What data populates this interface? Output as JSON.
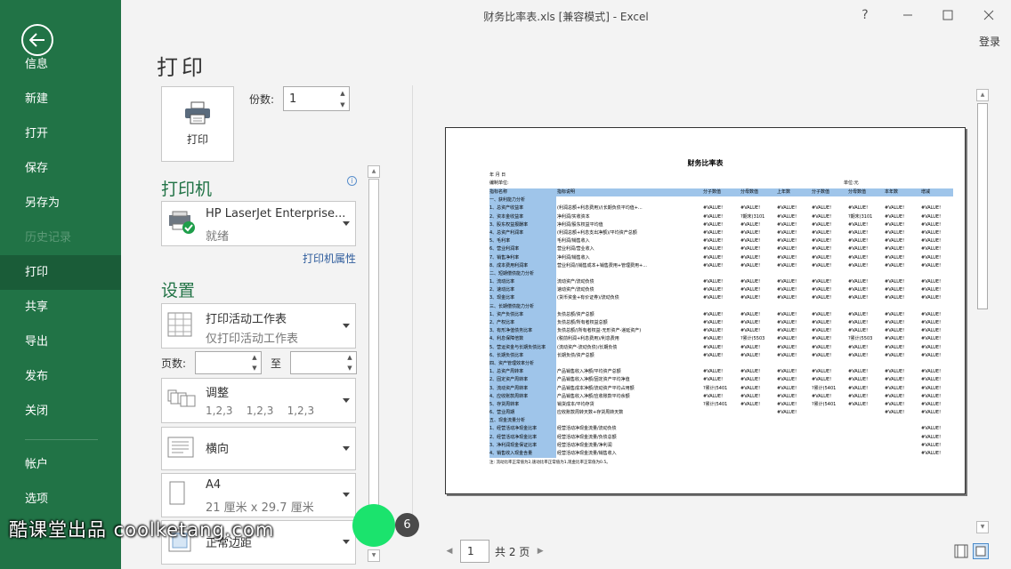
{
  "window": {
    "title": "财务比率表.xls  [兼容模式] - Excel",
    "help_label": "?",
    "login_label": "登录"
  },
  "nav": {
    "items": [
      {
        "label": "信息"
      },
      {
        "label": "新建"
      },
      {
        "label": "打开"
      },
      {
        "label": "保存"
      },
      {
        "label": "另存为"
      },
      {
        "label": "历史记录",
        "disabled": true
      },
      {
        "label": "打印",
        "active": true
      },
      {
        "label": "共享"
      },
      {
        "label": "导出"
      },
      {
        "label": "发布"
      },
      {
        "label": "关闭"
      },
      {
        "label": "帐户"
      },
      {
        "label": "选项"
      }
    ]
  },
  "print_panel": {
    "heading": "打印",
    "print_button_label": "打印",
    "copies_label": "份数:",
    "copies_value": "1",
    "printer_section": "打印机",
    "printer_name": "HP LaserJet Enterprise...",
    "printer_status": "就绪",
    "printer_properties_link": "打印机属性",
    "settings_section": "设置",
    "scope_main": "打印活动工作表",
    "scope_sub": "仅打印活动工作表",
    "pages_label": "页数:",
    "pages_to_label": "至",
    "collate_main": "调整",
    "collate_sub": "1,2,3    1,2,3    1,2,3",
    "orientation": "横向",
    "paper_main": "A4",
    "paper_sub": "21 厘米 x 29.7 厘米",
    "margins_main": "正常边距"
  },
  "preview": {
    "page_title": "财务比率表",
    "date_line": "年    月    日",
    "unit_left": "编制单位:",
    "unit_right": "单位:元",
    "headers": [
      "指标名称",
      "指标说明",
      "分子数值",
      "分母数值",
      "上年数",
      "分子数值",
      "分母数值",
      "本年数",
      "增减"
    ],
    "rows": [
      {
        "name": "一、获利能力分析",
        "desc": "",
        "section": true
      },
      {
        "name": "1、总资产收益率",
        "desc": "(利润总额+利息费用)/(长期负债平均值+...",
        "vals": [
          "#VALUE!",
          "#VALUE!",
          "#VALUE!",
          "#VALUE!",
          "#VALUE!",
          "#VALUE!",
          "#VALUE!"
        ]
      },
      {
        "name": "2、资本金收益率",
        "desc": "净利润/实收资本",
        "vals": [
          "#VALUE!",
          "?期末(3101",
          "#VALUE!",
          "#VALUE!",
          "?期末(3101",
          "#VALUE!",
          "#VALUE!"
        ]
      },
      {
        "name": "3、股东权益报酬率",
        "desc": "净利润/股东权益平均值",
        "vals": [
          "#VALUE!",
          "#VALUE!",
          "#VALUE!",
          "#VALUE!",
          "#VALUE!",
          "#VALUE!",
          "#VALUE!"
        ]
      },
      {
        "name": "4、总资产利润率",
        "desc": "(利润总额+利息支出净额)/平均资产总额",
        "vals": [
          "#VALUE!",
          "#VALUE!",
          "#VALUE!",
          "#VALUE!",
          "#VALUE!",
          "#VALUE!",
          "#VALUE!"
        ]
      },
      {
        "name": "5、毛利率",
        "desc": "毛利润/销售收入",
        "vals": [
          "#VALUE!",
          "#VALUE!",
          "#VALUE!",
          "#VALUE!",
          "#VALUE!",
          "#VALUE!",
          "#VALUE!"
        ]
      },
      {
        "name": "6、营业利润率",
        "desc": "营业利润/营业收入",
        "vals": [
          "#VALUE!",
          "#VALUE!",
          "#VALUE!",
          "#VALUE!",
          "#VALUE!",
          "#VALUE!",
          "#VALUE!"
        ]
      },
      {
        "name": "7、销售净利率",
        "desc": "净利润/销售收入",
        "vals": [
          "#VALUE!",
          "#VALUE!",
          "#VALUE!",
          "#VALUE!",
          "#VALUE!",
          "#VALUE!",
          "#VALUE!"
        ]
      },
      {
        "name": "8、成本费用利润率",
        "desc": "营业利润/(销售成本+销售费用+管理费用+...",
        "vals": [
          "#VALUE!",
          "#VALUE!",
          "#VALUE!",
          "#VALUE!",
          "#VALUE!",
          "#VALUE!",
          "#VALUE!"
        ]
      },
      {
        "name": "二、短期偿债能力分析",
        "desc": "",
        "section": true
      },
      {
        "name": "1、流动比率",
        "desc": "流动资产/流动负债",
        "vals": [
          "#VALUE!",
          "#VALUE!",
          "#VALUE!",
          "#VALUE!",
          "#VALUE!",
          "#VALUE!",
          "#VALUE!"
        ]
      },
      {
        "name": "2、速动比率",
        "desc": "速动资产/流动负债",
        "vals": [
          "#VALUE!",
          "#VALUE!",
          "#VALUE!",
          "#VALUE!",
          "#VALUE!",
          "#VALUE!",
          "#VALUE!"
        ]
      },
      {
        "name": "3、现金比率",
        "desc": "(货币资金+有价证券)/流动负债",
        "vals": [
          "#VALUE!",
          "#VALUE!",
          "#VALUE!",
          "#VALUE!",
          "#VALUE!",
          "#VALUE!",
          "#VALUE!"
        ]
      },
      {
        "name": "三、长期偿债能力分析",
        "desc": "",
        "section": true
      },
      {
        "name": "1、资产负债比率",
        "desc": "负债总额/资产总额",
        "vals": [
          "#VALUE!",
          "#VALUE!",
          "#VALUE!",
          "#VALUE!",
          "#VALUE!",
          "#VALUE!",
          "#VALUE!"
        ]
      },
      {
        "name": "2、产权比率",
        "desc": "负债总额/所有者权益总额",
        "vals": [
          "#VALUE!",
          "#VALUE!",
          "#VALUE!",
          "#VALUE!",
          "#VALUE!",
          "#VALUE!",
          "#VALUE!"
        ]
      },
      {
        "name": "3、有形净值债务比率",
        "desc": "负债总额/(所有者权益-无形资产-递延资产)",
        "vals": [
          "#VALUE!",
          "#VALUE!",
          "#VALUE!",
          "#VALUE!",
          "#VALUE!",
          "#VALUE!",
          "#VALUE!"
        ]
      },
      {
        "name": "4、利息保障倍数",
        "desc": "(税前利润+利息费用)/利息费用",
        "vals": [
          "#VALUE!",
          "?累计(5503",
          "#VALUE!",
          "#VALUE!",
          "?累计(5503",
          "#VALUE!",
          "#VALUE!"
        ]
      },
      {
        "name": "5、营运资金与长期负债比率",
        "desc": "(流动资产-流动负债)/长期负债",
        "vals": [
          "#VALUE!",
          "#VALUE!",
          "#VALUE!",
          "#VALUE!",
          "#VALUE!",
          "#VALUE!",
          "#VALUE!"
        ]
      },
      {
        "name": "6、长期负债比率",
        "desc": "长期负债/资产总额",
        "vals": [
          "#VALUE!",
          "#VALUE!",
          "#VALUE!",
          "#VALUE!",
          "#VALUE!",
          "#VALUE!",
          "#VALUE!"
        ]
      },
      {
        "name": "四、资产管理效率分析",
        "desc": "",
        "section": true
      },
      {
        "name": "1、总资产周转率",
        "desc": "产品销售收入净额/平均资产总额",
        "vals": [
          "#VALUE!",
          "#VALUE!",
          "#VALUE!",
          "#VALUE!",
          "#VALUE!",
          "#VALUE!",
          "#VALUE!"
        ]
      },
      {
        "name": "2、固定资产周转率",
        "desc": "产品销售收入净额/固定资产平均净值",
        "vals": [
          "#VALUE!",
          "#VALUE!",
          "#VALUE!",
          "#VALUE!",
          "#VALUE!",
          "#VALUE!",
          "#VALUE!"
        ]
      },
      {
        "name": "3、流动资产周转率",
        "desc": "产品销售成本净额/流动资产平均占用额",
        "vals": [
          "?累计(5401",
          "#VALUE!",
          "#VALUE!",
          "?累计(5401",
          "#VALUE!",
          "#VALUE!",
          "#VALUE!"
        ]
      },
      {
        "name": "4、应收账款周转率",
        "desc": "产品销售收入净额/应收账款平均余额",
        "vals": [
          "#VALUE!",
          "#VALUE!",
          "#VALUE!",
          "#VALUE!",
          "#VALUE!",
          "#VALUE!",
          "#VALUE!"
        ]
      },
      {
        "name": "5、存货周转率",
        "desc": "销货成本/平均存货",
        "vals": [
          "?累计(5401",
          "#VALUE!",
          "#VALUE!",
          "?累计(5401",
          "#VALUE!",
          "#VALUE!",
          "#VALUE!"
        ]
      },
      {
        "name": "6、营业周期",
        "desc": "应收账款周转天数+存货周转天数",
        "vals": [
          "",
          "",
          "#VALUE!",
          "",
          "",
          "#VALUE!",
          "#VALUE!"
        ]
      },
      {
        "name": "五、现金流量分析",
        "desc": "",
        "section": true
      },
      {
        "name": "1、经营活动净现金比率",
        "desc": "经营活动净现金流量/流动负债",
        "vals": [
          "",
          "",
          "",
          "",
          "",
          "",
          "#VALUE!"
        ]
      },
      {
        "name": "2、经营活动净现金比率",
        "desc": "经营活动净现金流量/负债总额",
        "vals": [
          "",
          "",
          "",
          "",
          "",
          "",
          "#VALUE!"
        ]
      },
      {
        "name": "3、净利润现金保证比率",
        "desc": "经营活动净现金流量/净利润",
        "vals": [
          "",
          "",
          "",
          "",
          "",
          "",
          "#VALUE!"
        ]
      },
      {
        "name": "4、销售收入现金含量",
        "desc": "经营活动净现金流量/销售收入",
        "vals": [
          "",
          "",
          "",
          "",
          "",
          "",
          "#VALUE!"
        ]
      }
    ],
    "footnote": "注:    流动比率正常值为2,速动比率正常值为1,现金比率正常值为0.5。"
  },
  "pager": {
    "current_page": "1",
    "total_text": "共 2 页"
  },
  "overlay": {
    "watermark": "酷课堂出品 coolketang.com",
    "step_badge": "6"
  }
}
